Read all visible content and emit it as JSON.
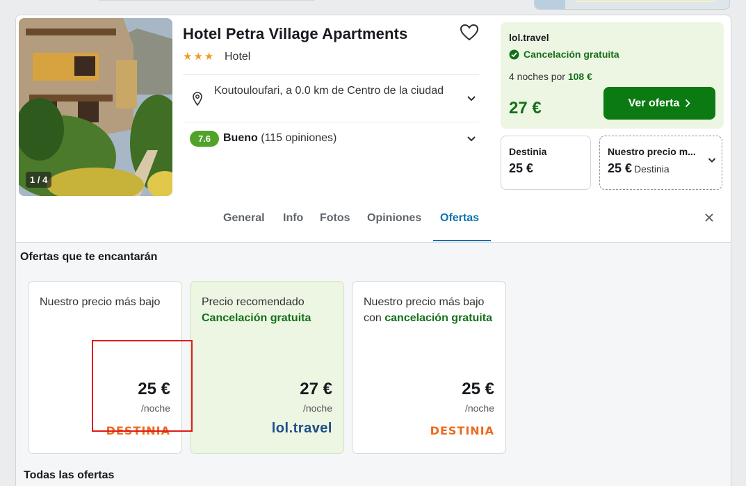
{
  "hotel": {
    "name": "Hotel Petra Village Apartments",
    "stars": "★★★",
    "type": "Hotel",
    "photo_counter": "1 / 4",
    "location": "Koutouloufari, a 0.0 km de Centro de la ciudad",
    "rating_score": "7.6",
    "rating_word": "Bueno",
    "rating_count": "(115 opiniones)"
  },
  "deal": {
    "provider": "lol.travel",
    "cancellation": "Cancelación gratuita",
    "nights_prefix": "4 noches por",
    "nights_total": "108 €",
    "price": "27 €",
    "cta": "Ver oferta"
  },
  "alt_offers": [
    {
      "label": "Destinia",
      "price": "25 €",
      "sub": ""
    },
    {
      "label": "Nuestro precio m...",
      "price": "25 €",
      "sub": "Destinia"
    }
  ],
  "tabs": [
    {
      "label": "General",
      "active": false
    },
    {
      "label": "Info",
      "active": false
    },
    {
      "label": "Fotos",
      "active": false
    },
    {
      "label": "Opiniones",
      "active": false
    },
    {
      "label": "Ofertas",
      "active": true
    }
  ],
  "offers_section": {
    "heading": "Ofertas que te encantarán",
    "cards": [
      {
        "text": "Nuestro precio más bajo",
        "green": "",
        "price": "25 €",
        "unit": "/noche",
        "logo": "DESTINIA"
      },
      {
        "text": "Precio recomendado",
        "green": "Cancelación gratuita",
        "price": "27 €",
        "unit": "/noche",
        "logo": "lol.travel"
      },
      {
        "text": "Nuestro precio más bajo con",
        "green": "cancelación gratuita",
        "price": "25 €",
        "unit": "/noche",
        "logo": "DESTINIA"
      }
    ],
    "all_offers_heading": "Todas las ofertas"
  },
  "colors": {
    "accent_blue": "#0a73b0",
    "deal_green": "#137017",
    "button_green": "#0b7a12",
    "rating_green": "#50a228",
    "destinia_orange": "#ec6b1d",
    "highlight_red": "#e01b1b"
  },
  "icons": {
    "favorite": "heart-outline-icon",
    "location": "map-pin-icon",
    "expand": "chevron-down-icon",
    "check": "check-circle-icon",
    "close": "close-icon",
    "arrow": "chevron-right-icon"
  }
}
